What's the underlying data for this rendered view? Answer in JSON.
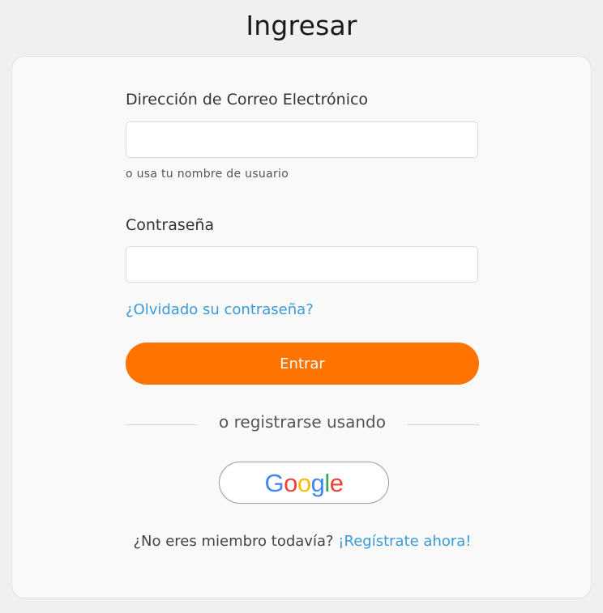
{
  "page": {
    "title": "Ingresar"
  },
  "form": {
    "email_label": "Dirección de Correo Electrónico",
    "email_value": "",
    "email_placeholder": "",
    "email_hint": "o usa tu nombre de usuario",
    "password_label": "Contraseña",
    "password_value": "",
    "password_placeholder": "",
    "forgot_link": "¿Olvidado su contraseña?",
    "submit_label": "Entrar"
  },
  "social": {
    "divider_text": "o registrarse usando",
    "google_logo_letters": [
      "G",
      "o",
      "o",
      "g",
      "l",
      "e"
    ],
    "google_logo_colors": [
      "#4285F4",
      "#EA4335",
      "#FBBC05",
      "#4285F4",
      "#34A853",
      "#EA4335"
    ]
  },
  "signup": {
    "prompt": "¿No eres miembro todavía?",
    "link": "¡Regístrate ahora!"
  },
  "colors": {
    "accent": "#FF7300",
    "link": "#3A9AD9",
    "background": "#F0F0F0",
    "card": "#F9F9F9"
  }
}
